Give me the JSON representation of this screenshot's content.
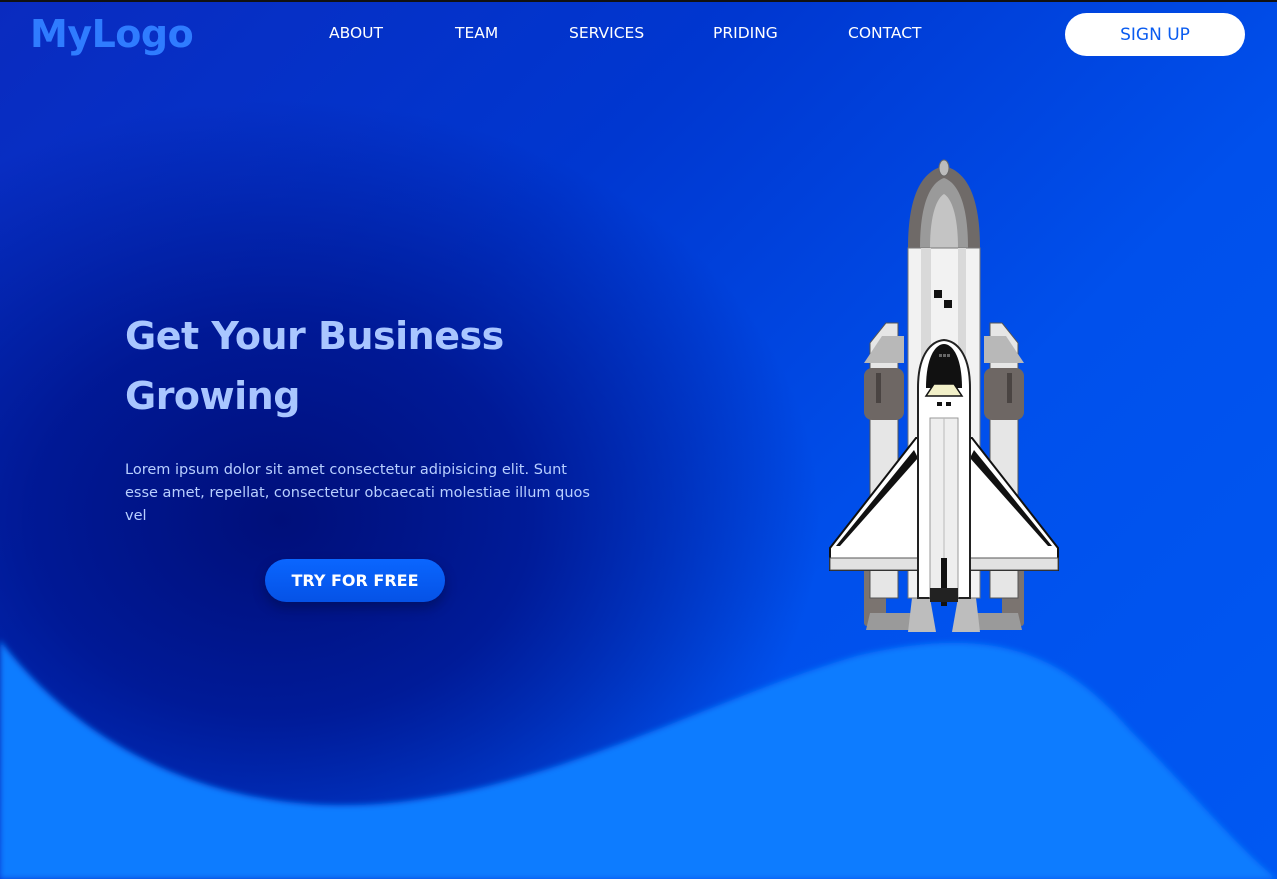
{
  "nav": {
    "logo": "MyLogo",
    "items": [
      {
        "label": "ABOUT"
      },
      {
        "label": "TEAM"
      },
      {
        "label": "SERVICES"
      },
      {
        "label": "PRIDING"
      },
      {
        "label": "CONTACT"
      }
    ],
    "signup_label": "SIGN UP"
  },
  "hero": {
    "title": "Get Your Business Growing",
    "text": "Lorem ipsum dolor sit amet consectetur adipisicing elit. Sunt esse amet, repellat, consectetur obcaecati molestiae illum quos vel",
    "cta_label": "TRY FOR FREE",
    "illustration": "space-shuttle-rocket"
  },
  "colors": {
    "logo": "#2f7cff",
    "title": "#a9c6ff",
    "wave": "#0a7cff",
    "background_dark": "#000f7a",
    "background_bright": "#0058f2",
    "button": "#0a66ff"
  }
}
